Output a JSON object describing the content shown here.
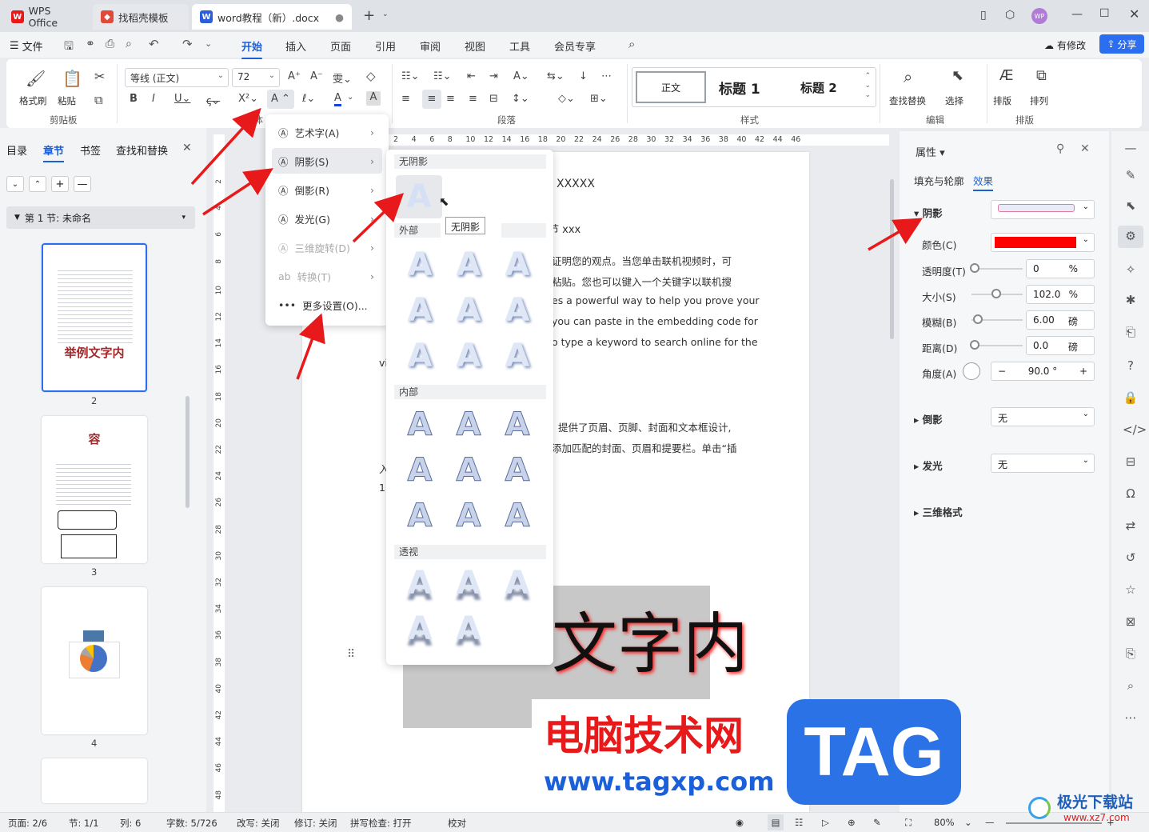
{
  "titlebar": {
    "tabs": [
      {
        "label": "WPS Office"
      },
      {
        "label": "找稻壳模板"
      },
      {
        "label": "word教程（新）.docx"
      }
    ],
    "avatar": "WP"
  },
  "menubar": {
    "file": "文件",
    "items": [
      "开始",
      "插入",
      "页面",
      "引用",
      "审阅",
      "视图",
      "工具",
      "会员专享"
    ],
    "modified": "有修改",
    "share": "分享"
  },
  "ribbon": {
    "clipboard": {
      "format_painter": "格式刷",
      "paste": "粘贴",
      "label": "剪贴板"
    },
    "font": {
      "name": "等线 (正文)",
      "size": "72",
      "label": "字体"
    },
    "paragraph": {
      "label": "段落"
    },
    "styles": {
      "normal": "正文",
      "h1": "标题 1",
      "h2": "标题 2",
      "label": "样式"
    },
    "edit": {
      "find_replace": "查找替换",
      "select": "选择",
      "label": "编辑"
    },
    "arrange": {
      "layout": "排版",
      "arrange": "排列",
      "label": "排版"
    }
  },
  "leftpanel": {
    "tabs": [
      "目录",
      "章节",
      "书签",
      "查找和替换"
    ],
    "section": "第 1 节: 未命名",
    "page_numbers": [
      "2",
      "3",
      "4"
    ],
    "thumb2_title": "举例文字内",
    "thumb3_title": "容"
  },
  "document": {
    "heading": "XXXXX",
    "subheading": "节 xxx",
    "lines": [
      "证明您的观点。当您单击联机视频时，可",
      "粘贴。您也可以键入一个关键字以联机搜",
      "es a powerful way to help you prove your",
      "you can paste in the embedding code for",
      "o type a keyword to search online for the",
      "vi",
      "提供了页眉、页脚、封面和文本框设计,",
      "添加匹配的封面、页眉和提要栏。单击“插",
      "入",
      "1."
    ],
    "big_text": "文字内",
    "ruler_nums": [
      "2",
      "4",
      "6",
      "8",
      "10",
      "12",
      "14",
      "16",
      "18",
      "20",
      "22",
      "24",
      "26",
      "28",
      "30",
      "32",
      "34",
      "36",
      "38",
      "40",
      "42",
      "44",
      "46"
    ],
    "vruler_nums": [
      "2",
      "4",
      "6",
      "8",
      "10",
      "12",
      "14",
      "16",
      "18",
      "20",
      "22",
      "24",
      "26",
      "28",
      "30",
      "32",
      "34",
      "36",
      "38",
      "40",
      "42",
      "44",
      "46",
      "48"
    ]
  },
  "menu1": {
    "items": [
      {
        "label": "艺术字(A)"
      },
      {
        "label": "阴影(S)"
      },
      {
        "label": "倒影(R)"
      },
      {
        "label": "发光(G)"
      },
      {
        "label": "三维旋转(D)"
      },
      {
        "label": "转换(T)"
      },
      {
        "label": "更多设置(O)..."
      }
    ]
  },
  "menu2": {
    "no_shadow": "无阴影",
    "outer": "外部",
    "inner": "内部",
    "perspective": "透视",
    "tooltip": "无阴影",
    "glyph": "A"
  },
  "properties": {
    "title": "属性",
    "tabs": [
      "填充与轮廓",
      "效果"
    ],
    "shadow": "阴影",
    "color": "颜色(C)",
    "color_value": "#ff0000",
    "transparency": "透明度(T)",
    "transparency_val": "0",
    "transparency_unit": "%",
    "size": "大小(S)",
    "size_val": "102.0",
    "size_unit": "%",
    "blur": "模糊(B)",
    "blur_val": "6.00",
    "blur_unit": "磅",
    "distance": "距离(D)",
    "distance_val": "0.0",
    "distance_unit": "磅",
    "angle": "角度(A)",
    "angle_val": "90.0 °",
    "reflection": "倒影",
    "reflection_val": "无",
    "glow": "发光",
    "glow_val": "无",
    "threed": "三维格式"
  },
  "statusbar": {
    "page": "页面: 2/6",
    "section": "节: 1/1",
    "col": "列: 6",
    "words": "字数: 5/726",
    "overwrite": "改写: 关闭",
    "revise": "修订: 关闭",
    "spell": "拼写检查: 打开",
    "proof": "校对",
    "zoom": "80%"
  },
  "watermark": {
    "cn": "电脑技术网",
    "url": "www.tagxp.com",
    "tag": "TAG",
    "logo_text": "极光下载站",
    "logo_url": "www.xz7.com"
  },
  "colors": {
    "accent": "#1b5fd9",
    "red": "#ff0000",
    "arrow": "#e8191b"
  }
}
